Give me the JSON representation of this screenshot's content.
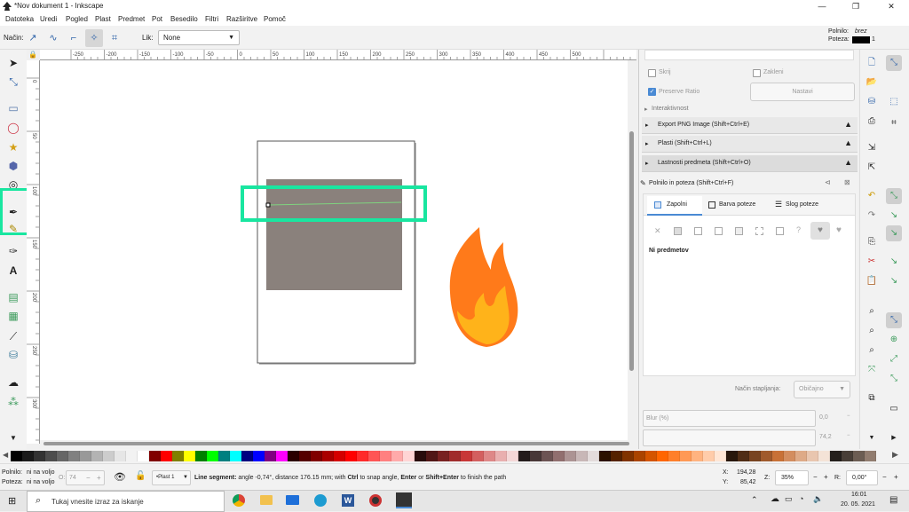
{
  "window": {
    "title": "*Nov dokument 1 - Inkscape",
    "controls": [
      "—",
      "❐",
      "✕"
    ]
  },
  "menu": [
    "Datoteka",
    "Uredi",
    "Pogled",
    "Plast",
    "Predmet",
    "Pot",
    "Besedilo",
    "Filtri",
    "Razširitve",
    "Pomoč"
  ],
  "controls_bar": {
    "mode_label": "Način:",
    "shape_label": "Lik:",
    "shape_value": "None",
    "fill_label": "Polnilo:",
    "fill_value": "brez",
    "stroke_label": "Poteza:",
    "stroke_width": "1"
  },
  "rulers": {
    "horizontal": [
      "-250",
      "-200",
      "-150",
      "-100",
      "-50",
      "0",
      "50",
      "100",
      "150",
      "200",
      "250",
      "300",
      "350",
      "400",
      "450",
      "500"
    ],
    "vertical": [
      "0",
      "50",
      "100",
      "150",
      "200",
      "250",
      "300"
    ]
  },
  "right_panel": {
    "hide_label": "Skrij",
    "lock_label": "Zakleni",
    "preserve_ratio_label": "Preserve Ratio",
    "set_button": "Nastavi",
    "interactivity": "Interaktivnost",
    "docks": [
      "Export PNG Image (Shift+Ctrl+E)",
      "Plasti  (Shift+Ctrl+L)",
      "Lastnosti predmeta  (Shift+Ctrl+O)",
      "Polnilo in poteza  (Shift+Ctrl+F)"
    ],
    "tabs": [
      "Zapolni",
      "Barva poteze",
      "Slog poteze"
    ],
    "no_objects": "Ni predmetov",
    "blend_label": "Način stapljanja:",
    "blend_value": "Običajno",
    "blur_label": "Blur (%)",
    "blur_value": "0,0",
    "opacity_value": "74,2"
  },
  "status": {
    "fill_label": "Polnilo:",
    "fill_value": "ni na voljo",
    "stroke_label": "Poteza:",
    "stroke_value": "ni na voljo",
    "opacity_label": "O:",
    "opacity_value": "74",
    "layer": "•Plast 1",
    "message_bold": "Line segment:",
    "message_rest": " angle -0,74°, distance 176.15 mm; with ",
    "message_ctrl": "Ctrl",
    "message_rest2": " to snap angle, ",
    "message_enter": "Enter",
    "message_or": " or ",
    "message_shiftenter": "Shift+Enter",
    "message_end": " to finish the path",
    "x_label": "X:",
    "x_value": "194,28",
    "y_label": "Y:",
    "y_value": "85,42",
    "zoom_label": "Z:",
    "zoom_value": "35%",
    "rot_label": "R:",
    "rot_value": "0,00°"
  },
  "taskbar": {
    "search_placeholder": "Tukaj vnesite izraz za iskanje",
    "time": "16:01",
    "date": "20. 05. 2021"
  },
  "colors": {
    "accent_highlight": "#19e6a0",
    "rect_fill": "#8a817c",
    "flame_outer": "#ff7a1a",
    "flame_inner": "#ffb31a"
  },
  "palette": [
    "#000000",
    "#1a1a1a",
    "#333333",
    "#4d4d4d",
    "#666666",
    "#808080",
    "#999999",
    "#b3b3b3",
    "#cccccc",
    "#e6e6e6",
    "#f2f2f2",
    "#ffffff",
    "#800000",
    "#ff0000",
    "#808000",
    "#ffff00",
    "#008000",
    "#00ff00",
    "#008080",
    "#00ffff",
    "#000080",
    "#0000ff",
    "#800080",
    "#ff00ff",
    "#2b0000",
    "#550000",
    "#800000",
    "#aa0000",
    "#d40000",
    "#ff0000",
    "#ff2a2a",
    "#ff5555",
    "#ff8080",
    "#ffaaaa",
    "#ffd5d5",
    "#280b0b",
    "#501616",
    "#782121",
    "#a02c2c",
    "#c83737",
    "#d35f5f",
    "#de8787",
    "#e9afaf",
    "#f4d7d7",
    "#241c1c",
    "#483737",
    "#6c5353",
    "#916f6f",
    "#ac9393",
    "#c8b7b7",
    "#e3dbdb",
    "#2b1100",
    "#552200",
    "#803300",
    "#aa4400",
    "#d45500",
    "#ff6600",
    "#ff7f2a",
    "#ff9955",
    "#ffb380",
    "#ffccaa",
    "#ffe6d5",
    "#28170b",
    "#502d16",
    "#784421",
    "#a05a2c",
    "#c87137",
    "#d38d5f",
    "#deaa87",
    "#e9c6af",
    "#f4e3d7",
    "#241f1c",
    "#483e37",
    "#6c5d53",
    "#917c6f"
  ]
}
